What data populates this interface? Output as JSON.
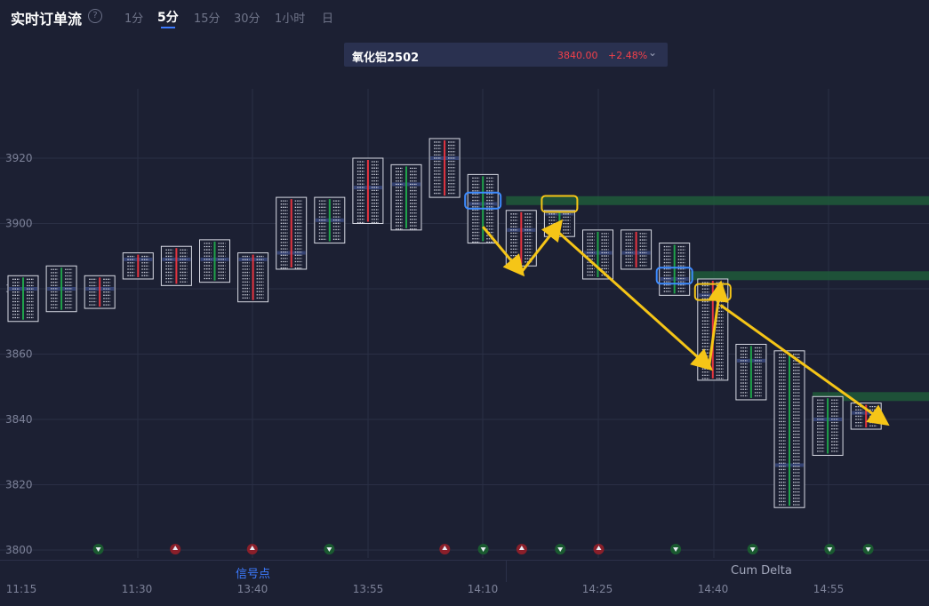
{
  "header": {
    "title": "实时订单流",
    "help_icon": "?",
    "tabs": [
      {
        "label": "1分",
        "active": false
      },
      {
        "label": "5分",
        "active": true
      },
      {
        "label": "15分",
        "active": false
      },
      {
        "label": "30分",
        "active": false
      },
      {
        "label": "1小时",
        "active": false
      },
      {
        "label": "日",
        "active": false
      }
    ]
  },
  "instrument": {
    "name": "氧化铝2502",
    "price": "3840.00",
    "change": "+2.48%",
    "dropdown_icon": "chevron-down-icon"
  },
  "bottom": {
    "signal_label": "信号点",
    "cum_delta_label": "Cum Delta"
  },
  "colors": {
    "background": "#1c2033",
    "up": "#e5343f",
    "down": "#1fa24a",
    "arrow": "#f5c517",
    "highlight_blue": "#3d8bff",
    "accent": "#3d7bff"
  },
  "chart_data": {
    "type": "footprint",
    "ylim": [
      3800,
      3915
    ],
    "yticks": [
      3800,
      3820,
      3840,
      3860,
      3880,
      3900,
      3920
    ],
    "xtick_labels": [
      "11:15",
      "11:30",
      "13:40",
      "13:55",
      "14:10",
      "14:25",
      "14:40",
      "14:55"
    ],
    "grid": true,
    "candles": [
      {
        "high": 3884,
        "low": 3870,
        "poc": 3880,
        "dir": "down"
      },
      {
        "high": 3887,
        "low": 3873,
        "poc": 3880,
        "dir": "down"
      },
      {
        "high": 3884,
        "low": 3874,
        "poc": 3880,
        "dir": "up"
      },
      {
        "high": 3891,
        "low": 3883,
        "poc": 3889,
        "dir": "up"
      },
      {
        "high": 3893,
        "low": 3881,
        "poc": 3889,
        "dir": "up"
      },
      {
        "high": 3895,
        "low": 3882,
        "poc": 3889,
        "dir": "down"
      },
      {
        "high": 3891,
        "low": 3876,
        "poc": 3889,
        "dir": "up"
      },
      {
        "high": 3908,
        "low": 3886,
        "poc": 3891,
        "dir": "up"
      },
      {
        "high": 3908,
        "low": 3894,
        "poc": 3901,
        "dir": "down"
      },
      {
        "high": 3920,
        "low": 3900,
        "poc": 3911,
        "dir": "up"
      },
      {
        "high": 3918,
        "low": 3898,
        "poc": 3912,
        "dir": "down"
      },
      {
        "high": 3926,
        "low": 3908,
        "poc": 3920,
        "dir": "up"
      },
      {
        "high": 3915,
        "low": 3894,
        "poc": 3906,
        "dir": "down"
      },
      {
        "high": 3904,
        "low": 3887,
        "poc": 3898,
        "dir": "up"
      },
      {
        "high": 3904,
        "low": 3896,
        "poc": 3903,
        "dir": "down"
      },
      {
        "high": 3898,
        "low": 3883,
        "poc": 3891,
        "dir": "down"
      },
      {
        "high": 3898,
        "low": 3886,
        "poc": 3891,
        "dir": "up"
      },
      {
        "high": 3894,
        "low": 3878,
        "poc": 3883,
        "dir": "down"
      },
      {
        "high": 3883,
        "low": 3852,
        "poc": 3878,
        "dir": "up"
      },
      {
        "high": 3863,
        "low": 3846,
        "poc": 3858,
        "dir": "down"
      },
      {
        "high": 3861,
        "low": 3813,
        "poc": 3826,
        "dir": "down"
      },
      {
        "high": 3847,
        "low": 3829,
        "poc": 3840,
        "dir": "down"
      },
      {
        "high": 3845,
        "low": 3837,
        "poc": 3842,
        "dir": "up"
      }
    ],
    "zones": [
      {
        "price": 3907,
        "from_candle": 13
      },
      {
        "price": 3884,
        "from_candle": 17
      },
      {
        "price": 3847,
        "from_candle": 21
      }
    ],
    "signal_markers": [
      {
        "candle": 2,
        "type": "down"
      },
      {
        "candle": 4,
        "type": "up"
      },
      {
        "candle": 6,
        "type": "up"
      },
      {
        "candle": 8,
        "type": "down"
      },
      {
        "candle": 11,
        "type": "up"
      },
      {
        "candle": 12,
        "type": "down"
      },
      {
        "candle": 13,
        "type": "up"
      },
      {
        "candle": 14,
        "type": "down"
      },
      {
        "candle": 15,
        "type": "up"
      },
      {
        "candle": 17,
        "type": "down"
      },
      {
        "candle": 19,
        "type": "down"
      },
      {
        "candle": 21,
        "type": "down"
      },
      {
        "candle": 22,
        "type": "down"
      }
    ]
  }
}
